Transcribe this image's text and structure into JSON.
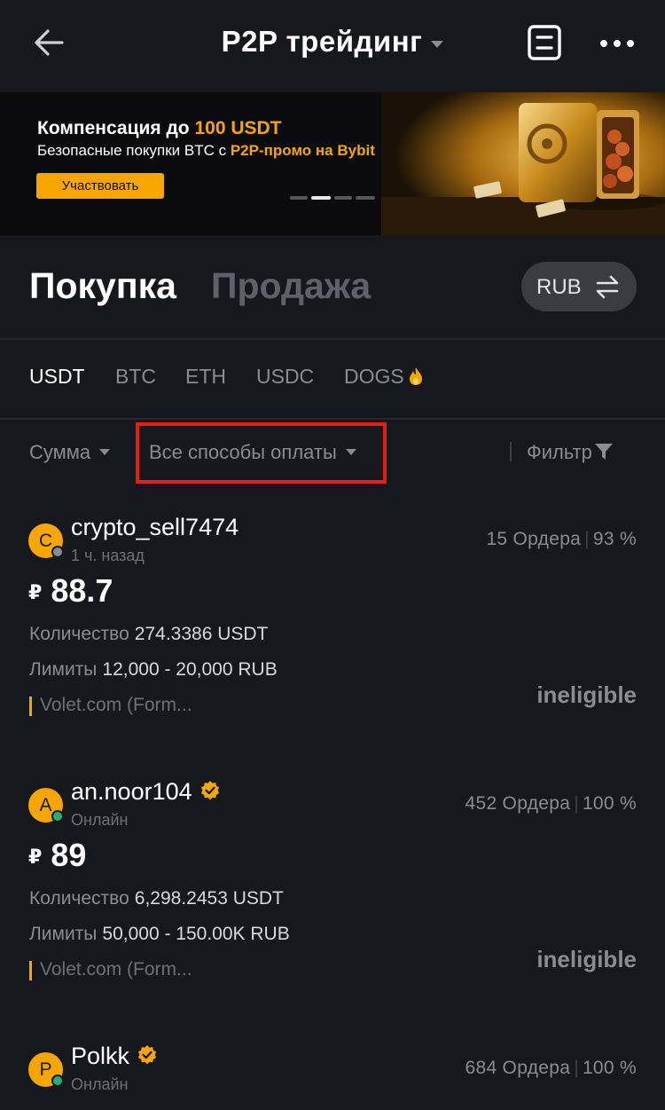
{
  "header": {
    "title": "P2P трейдинг"
  },
  "banner": {
    "title_prefix": "Компенсация до ",
    "title_highlight": "100 USDT",
    "subtitle_prefix": "Безопасные покупки BTC с ",
    "subtitle_highlight": "P2P-промо на Bybit",
    "button_label": "Участвовать",
    "active_slide": 2,
    "slide_count": 4
  },
  "trade_tabs": {
    "buy_label": "Покупка",
    "sell_label": "Продажа",
    "currency": "RUB"
  },
  "coins": [
    "USDT",
    "BTC",
    "ETH",
    "USDC",
    "DOGS"
  ],
  "selected_coin": "USDT",
  "filters": {
    "amount_label": "Сумма",
    "payment_label": "Все способы оплаты",
    "filter_label": "Фильтр"
  },
  "ads": [
    {
      "avatar_letter": "C",
      "username": "crypto_sell7474",
      "verified": false,
      "last_seen": "1 ч. назад",
      "online": false,
      "orders": "15 Ордера",
      "completion": "93 %",
      "currency_symbol": "₽",
      "price": "88.7",
      "quantity_label": "Количество",
      "quantity": "274.3386 USDT",
      "limits_label": "Лимиты",
      "limits": "12,000 - 20,000 RUB",
      "payment": "Volet.com (Form...",
      "status": "ineligible"
    },
    {
      "avatar_letter": "A",
      "username": "an.noor104",
      "verified": true,
      "last_seen": "Онлайн",
      "online": true,
      "orders": "452 Ордера",
      "completion": "100 %",
      "currency_symbol": "₽",
      "price": "89",
      "quantity_label": "Количество",
      "quantity": "6,298.2453 USDT",
      "limits_label": "Лимиты",
      "limits": "50,000 - 150.00K RUB",
      "payment": "Volet.com (Form...",
      "status": "ineligible"
    },
    {
      "avatar_letter": "P",
      "username": "Polkk",
      "verified": true,
      "last_seen": "Онлайн",
      "online": true,
      "orders": "684 Ордера",
      "completion": "100 %"
    }
  ],
  "colors": {
    "background": "#17181e",
    "accent": "#f7a600",
    "highlight_box": "#e3200f",
    "online": "#20b26c",
    "offline": "#8a8c94"
  }
}
